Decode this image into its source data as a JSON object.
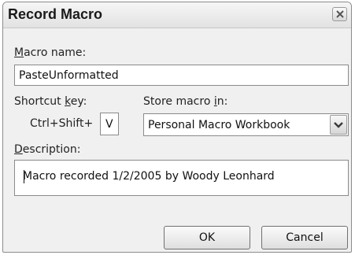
{
  "dialog": {
    "title": "Record Macro",
    "close_icon": "close-icon"
  },
  "macro_name": {
    "label_underlined": "M",
    "label_rest": "acro name:",
    "value": "PasteUnformatted"
  },
  "shortcut": {
    "label_before": "Shortcut ",
    "label_underlined": "k",
    "label_after": "ey:",
    "prefix": "Ctrl+Shift+",
    "value": "V"
  },
  "store_in": {
    "label_before": "Store macro ",
    "label_underlined": "i",
    "label_after": "n:",
    "selected": "Personal Macro Workbook",
    "dropdown_icon": "chevron-down-icon"
  },
  "description": {
    "label_underlined": "D",
    "label_rest": "escription:",
    "value": "Macro recorded 1/2/2005 by Woody Leonhard"
  },
  "buttons": {
    "ok": "OK",
    "cancel": "Cancel"
  }
}
